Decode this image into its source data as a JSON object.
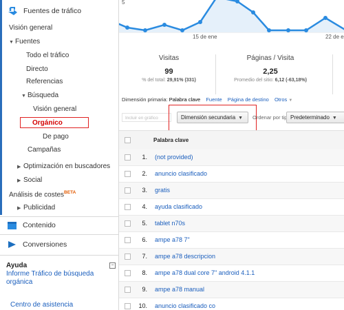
{
  "sidebar": {
    "acquisition_title": "Fuentes de tráfico",
    "nav": [
      {
        "label": "Visión general"
      },
      {
        "label": "Fuentes"
      },
      {
        "label": "Todo el tráfico"
      },
      {
        "label": "Directo"
      },
      {
        "label": "Referencias"
      },
      {
        "label": "Búsqueda"
      },
      {
        "label": "Visión general"
      },
      {
        "label": "Orgánico"
      },
      {
        "label": "De pago"
      },
      {
        "label": "Campañas"
      },
      {
        "label": "Optimización en buscadores"
      },
      {
        "label": "Social"
      },
      {
        "label": "Análisis de costes"
      },
      {
        "label": "Publicidad"
      }
    ],
    "beta_badge": "BETA",
    "content_title": "Contenido",
    "conversions_title": "Conversiones",
    "help": {
      "title": "Ayuda",
      "link": "Informe Tráfico de búsqueda orgánica",
      "link2": "Centro de asistencia"
    }
  },
  "chart": {
    "y_tick": "5",
    "x_labels": [
      "15 de ene",
      "22 de e"
    ],
    "line_color": "#2a8be0",
    "fill_color": "#e5f0fa"
  },
  "metrics": [
    {
      "title": "Visitas",
      "value": "99",
      "sub_prefix": "% del total: ",
      "sub_value": "29,91% (331)"
    },
    {
      "title": "Páginas / Visita",
      "value": "2,25",
      "sub_prefix": "Promedio del sitio: ",
      "sub_value": "6,12 (-63,18%)"
    }
  ],
  "dimension_bar": {
    "label": "Dimensión primaria:",
    "current": "Palabra clave",
    "links": [
      "Fuente",
      "Página de destino",
      "Otros"
    ]
  },
  "filters": {
    "include_placeholder": "Incluir en gráfico",
    "secondary_dimension": "Dimensión secundaria",
    "order_label": "Ordenar por tipo:",
    "order_value": "Predeterminado"
  },
  "table": {
    "header": "Palabra clave",
    "rows": [
      {
        "num": "1.",
        "keyword": "(not provided)"
      },
      {
        "num": "2.",
        "keyword": "anuncio clasificado"
      },
      {
        "num": "3.",
        "keyword": "gratis"
      },
      {
        "num": "4.",
        "keyword": "ayuda clasificado"
      },
      {
        "num": "5.",
        "keyword": "tablet n70s"
      },
      {
        "num": "6.",
        "keyword": "ampe a78 7\""
      },
      {
        "num": "7.",
        "keyword": "ampe a78 descripcion"
      },
      {
        "num": "8.",
        "keyword": "ampe a78 dual core 7\" android 4.1.1"
      },
      {
        "num": "9.",
        "keyword": "ampe a78 manual"
      },
      {
        "num": "10.",
        "keyword": "anuncio clasificado co"
      }
    ]
  }
}
